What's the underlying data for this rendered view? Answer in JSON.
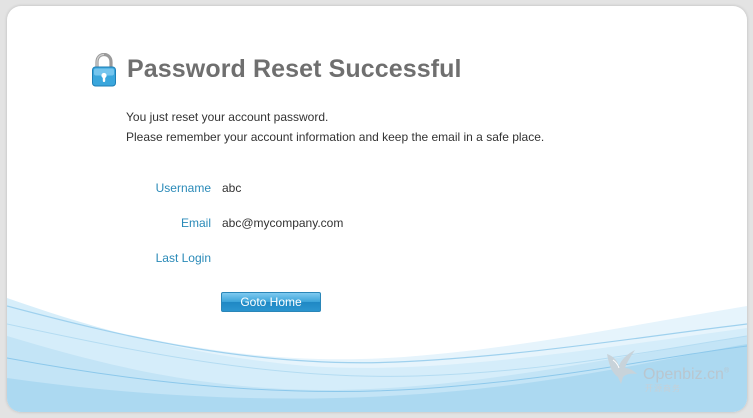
{
  "page": {
    "title": "Password Reset Successful",
    "message_line1": "You just reset your account password.",
    "message_line2": "Please remember your account information and keep the email in a safe place."
  },
  "account": {
    "username_label": "Username",
    "username_value": "abc",
    "email_label": "Email",
    "email_value": "abc@mycompany.com",
    "last_login_label": "Last Login",
    "last_login_value": ""
  },
  "actions": {
    "goto_home_label": "Goto Home"
  },
  "branding": {
    "logo_text": "Openbiz.cn",
    "logo_superscript": "®",
    "logo_subtext": "开源商务"
  },
  "icons": {
    "lock": "lock-icon",
    "logo_mark": "bird-logo-icon"
  },
  "colors": {
    "label": "#2a8ab8",
    "title": "#6f6f6f",
    "button": "#2b95cf",
    "wave": "#bfe2f5"
  }
}
